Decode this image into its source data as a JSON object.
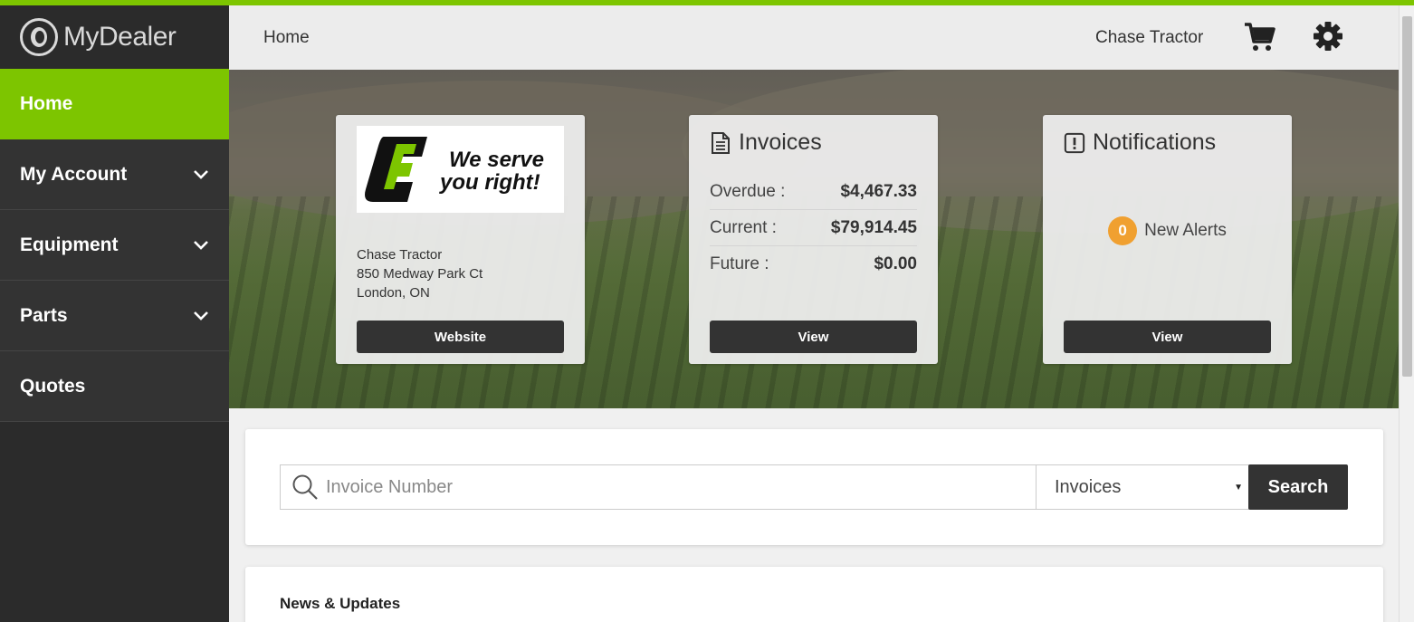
{
  "app": {
    "logo_text": "MyDealer"
  },
  "colors": {
    "accent": "#7dc500",
    "sidebar": "#2b2b2b",
    "dark_button": "#333333",
    "badge": "#f0a030"
  },
  "sidebar": {
    "items": [
      {
        "label": "Home",
        "active": true,
        "expandable": false
      },
      {
        "label": "My Account",
        "active": false,
        "expandable": true
      },
      {
        "label": "Equipment",
        "active": false,
        "expandable": true
      },
      {
        "label": "Parts",
        "active": false,
        "expandable": true
      },
      {
        "label": "Quotes",
        "active": false,
        "expandable": false
      }
    ]
  },
  "header": {
    "breadcrumb": "Home",
    "dealer_name": "Chase Tractor",
    "cart_icon": "cart-icon",
    "settings_icon": "gear-icon"
  },
  "dealer_card": {
    "logo_text_line1": "We serve",
    "logo_text_line2": "you right!",
    "name": "Chase Tractor",
    "street": "850 Medway Park Ct",
    "city": "London, ON",
    "button": "Website"
  },
  "invoices_card": {
    "title": "Invoices",
    "rows": [
      {
        "label": "Overdue :",
        "value": "$4,467.33"
      },
      {
        "label": "Current :",
        "value": "$79,914.45"
      },
      {
        "label": "Future :",
        "value": "$0.00"
      }
    ],
    "button": "View"
  },
  "notifications_card": {
    "title": "Notifications",
    "count": "0",
    "alerts_label": "New Alerts",
    "button": "View"
  },
  "search": {
    "placeholder": "Invoice Number",
    "selected_type": "Invoices",
    "button": "Search"
  },
  "news": {
    "title": "News & Updates"
  }
}
